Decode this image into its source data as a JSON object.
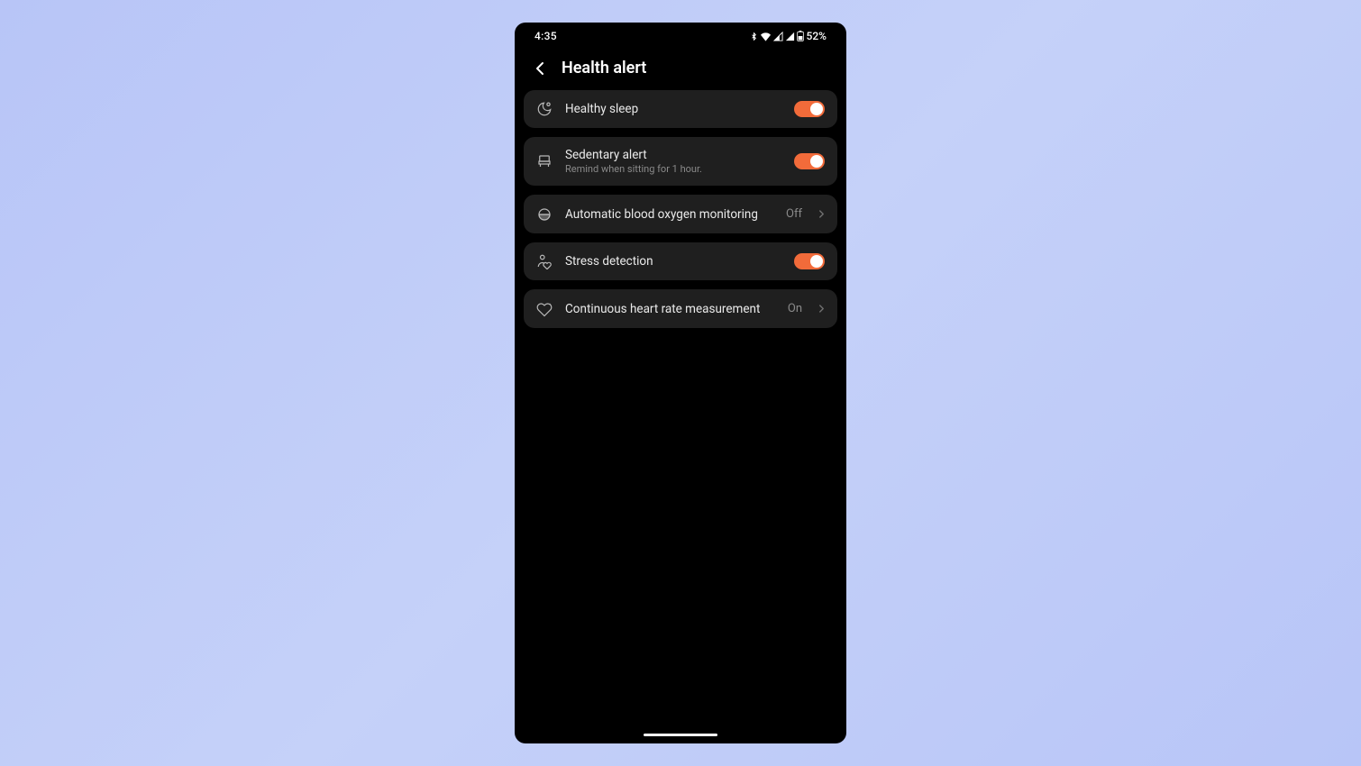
{
  "status": {
    "time": "4:35",
    "battery": "52%"
  },
  "header": {
    "title": "Health alert"
  },
  "settings": {
    "healthy_sleep": {
      "label": "Healthy sleep"
    },
    "sedentary": {
      "label": "Sedentary alert",
      "sub": "Remind when sitting for 1 hour."
    },
    "blood_oxygen": {
      "label": "Automatic blood oxygen monitoring",
      "value": "Off"
    },
    "stress": {
      "label": "Stress detection"
    },
    "heart_rate": {
      "label": "Continuous heart rate measurement",
      "value": "On"
    }
  }
}
